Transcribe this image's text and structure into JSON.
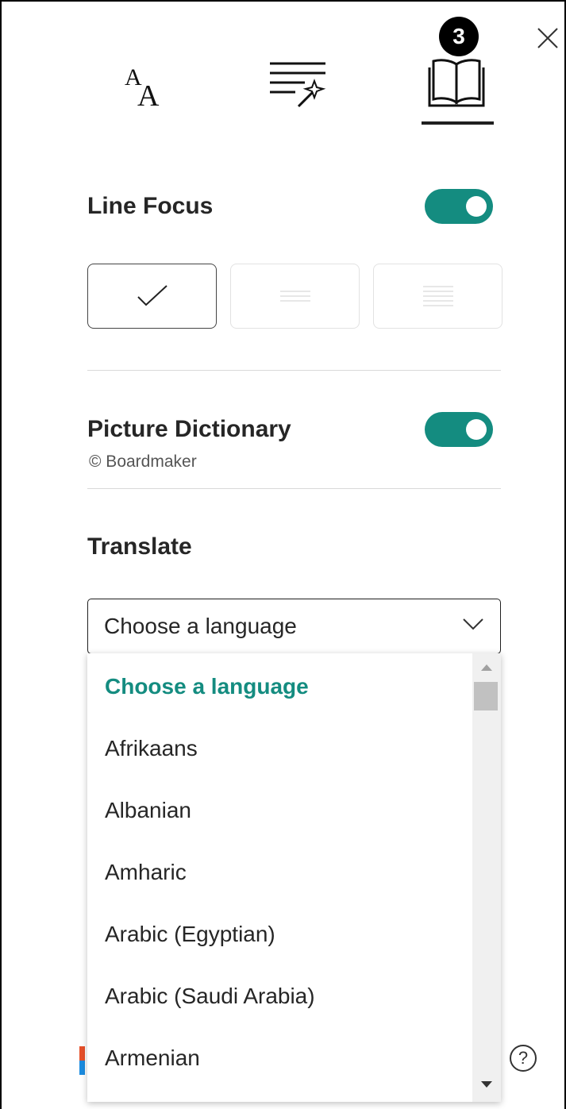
{
  "header": {
    "step_badge": "3",
    "tabs": [
      {
        "name": "text-preferences",
        "icon": "text-size-icon"
      },
      {
        "name": "grammar-options",
        "icon": "grammar-wand-icon"
      },
      {
        "name": "reading-preferences",
        "icon": "book-icon",
        "selected": true
      }
    ],
    "text_icon_glyph": "A",
    "text_icon_glyph_small": "A"
  },
  "line_focus": {
    "title": "Line Focus",
    "enabled": true,
    "options": [
      {
        "id": "one-line",
        "selected": true
      },
      {
        "id": "three-lines",
        "selected": false
      },
      {
        "id": "five-lines",
        "selected": false
      }
    ]
  },
  "picture_dictionary": {
    "title": "Picture Dictionary",
    "credit": "© Boardmaker",
    "enabled": true
  },
  "translate": {
    "title": "Translate",
    "selected_value": "Choose a language",
    "options": [
      "Choose a language",
      "Afrikaans",
      "Albanian",
      "Amharic",
      "Arabic (Egyptian)",
      "Arabic (Saudi Arabia)",
      "Armenian"
    ]
  },
  "help": {
    "glyph": "?"
  },
  "colors": {
    "accent": "#148c80",
    "badge": "#000000",
    "text": "#262626"
  }
}
